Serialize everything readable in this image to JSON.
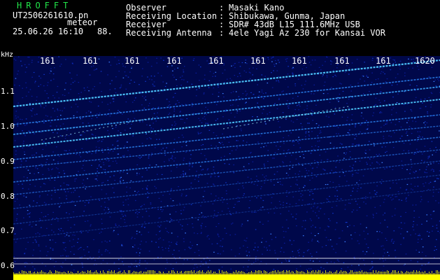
{
  "header": {
    "app_title": "HROFFT",
    "file_name": "UT2506261610.pn",
    "mode": "meteor",
    "date_time": "25.06.26 16:10",
    "level": "88.",
    "info": [
      {
        "label": "Observer",
        "value": "Masaki Kano"
      },
      {
        "label": "Receiving Location",
        "value": "Shibukawa, Gunma, Japan"
      },
      {
        "label": "Receiver",
        "value": "SDR# 43dB L15 111.6MHz USB"
      },
      {
        "label": "Receiving Antenna",
        "value": "4ele Yagi Az 230 for Kansai VOR"
      }
    ]
  },
  "spectrogram": {
    "y_unit": "kHz",
    "x_ticks": [
      "161",
      "161",
      "161",
      "161",
      "161",
      "161",
      "161",
      "161",
      "161",
      "1620"
    ],
    "y_ticks": [
      "1.1",
      "1.0",
      "0.9",
      "0.8",
      "0.7",
      "0.6"
    ],
    "colors": {
      "background": "#00084a",
      "echo_line": "#5ad8ff",
      "baseline_bar": "#ffff00",
      "reference_line": "#ffffff"
    }
  }
}
